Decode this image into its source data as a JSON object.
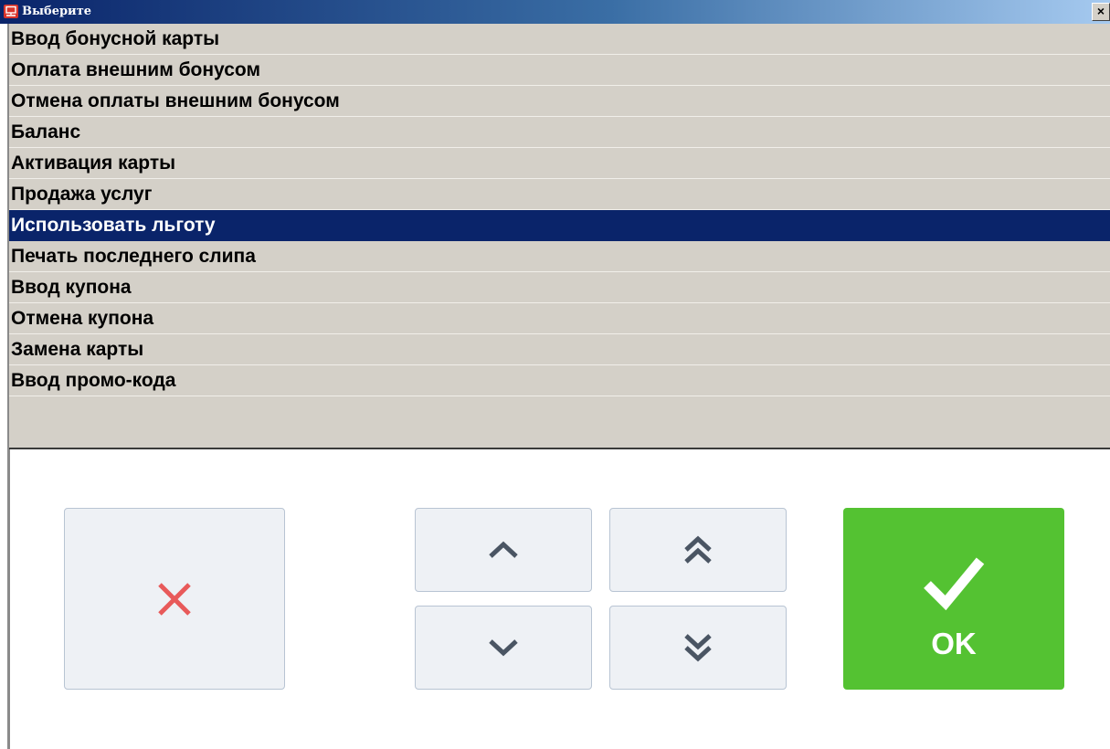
{
  "window": {
    "title": "Выберите",
    "close_label": "×"
  },
  "list": {
    "items": [
      "Ввод бонусной карты",
      "Оплата внешним бонусом",
      "Отмена оплаты внешним бонусом",
      "Баланс",
      "Активация карты",
      "Продажа услуг",
      "Использовать льготу",
      "Печать последнего слипа",
      "Ввод купона",
      "Отмена купона",
      "Замена карты",
      "Ввод промо-кода"
    ],
    "selected_index": 6
  },
  "buttons": {
    "ok_label": "OK"
  },
  "icons": {
    "cancel": "close-x-icon",
    "up": "chevron-up-icon",
    "down": "chevron-down-icon",
    "page_up": "double-chevron-up-icon",
    "page_down": "double-chevron-down-icon",
    "ok": "checkmark-icon"
  },
  "colors": {
    "titlebar": "#0a246a",
    "list_background": "#d4d0c8",
    "selection": "#0a246a",
    "ok_button": "#54c232",
    "cancel_icon": "#e85a5a",
    "arrow_icon": "#4a5563"
  }
}
